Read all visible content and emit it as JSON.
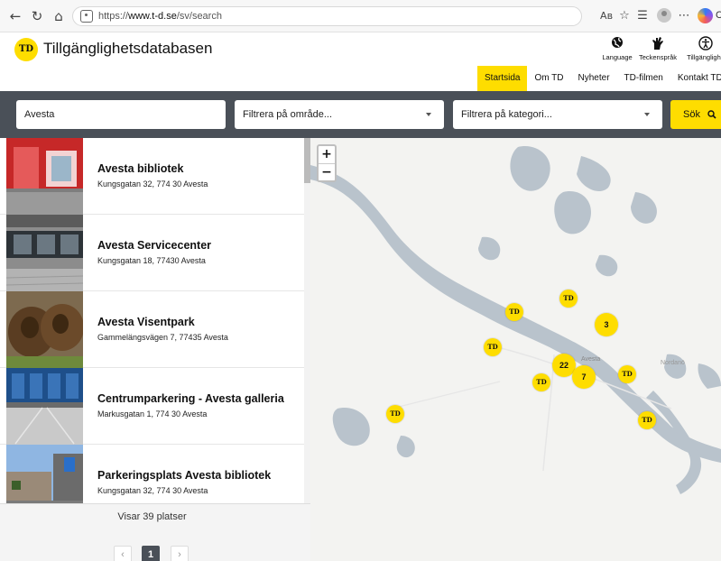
{
  "browser": {
    "url_prefix": "https://",
    "url_host": "www.t-d.se",
    "url_path": "/sv/search",
    "read_aloud_label": "Aʙ",
    "copilot_label": "C"
  },
  "header": {
    "logo": "TD",
    "title": "Tillgänglighetsdatabasen",
    "utility_links": [
      {
        "label": "Language",
        "icon": "globe-icon"
      },
      {
        "label": "Teckenspråk",
        "icon": "sign-language-icon"
      },
      {
        "label": "Tillgänglighe",
        "icon": "accessibility-icon"
      }
    ],
    "nav": [
      "Startsida",
      "Om TD",
      "Nyheter",
      "TD-filmen",
      "Kontakt TD"
    ],
    "active_nav": "Startsida"
  },
  "search": {
    "query": "Avesta",
    "area_placeholder": "Filtrera på område...",
    "category_placeholder": "Filtrera på kategori...",
    "button_label": "Sök"
  },
  "results": [
    {
      "name": "Avesta bibliotek",
      "address": "Kungsgatan 32, 774 30 Avesta"
    },
    {
      "name": "Avesta Servicecenter",
      "address": "Kungsgatan 18, 77430 Avesta"
    },
    {
      "name": "Avesta Visentpark",
      "address": "Gammelängsvägen 7, 77435 Avesta"
    },
    {
      "name": "Centrumparkering - Avesta galleria",
      "address": "Markusgatan 1, 774 30 Avesta"
    },
    {
      "name": "Parkeringsplats Avesta bibliotek",
      "address": "Kungsgatan 32, 774 30 Avesta"
    }
  ],
  "footer": {
    "count_text": "Visar 39 platser",
    "prev_label": "‹",
    "current_page": "1",
    "next_label": "›"
  },
  "map": {
    "zoom_in": "+",
    "zoom_out": "−",
    "place_labels": [
      "Avesta",
      "Nordanö"
    ],
    "markers": [
      {
        "label": "TD"
      },
      {
        "label": "TD"
      },
      {
        "label": "TD"
      },
      {
        "label": "TD"
      },
      {
        "label": "TD"
      },
      {
        "label": "TD"
      },
      {
        "label": "TD"
      },
      {
        "label": "3"
      },
      {
        "label": "22"
      },
      {
        "label": "7"
      }
    ]
  },
  "colors": {
    "brand_yellow": "#fedd00",
    "search_strip": "#4a5058",
    "map_water": "#b9c3cc",
    "map_land": "#f3f3f1"
  }
}
